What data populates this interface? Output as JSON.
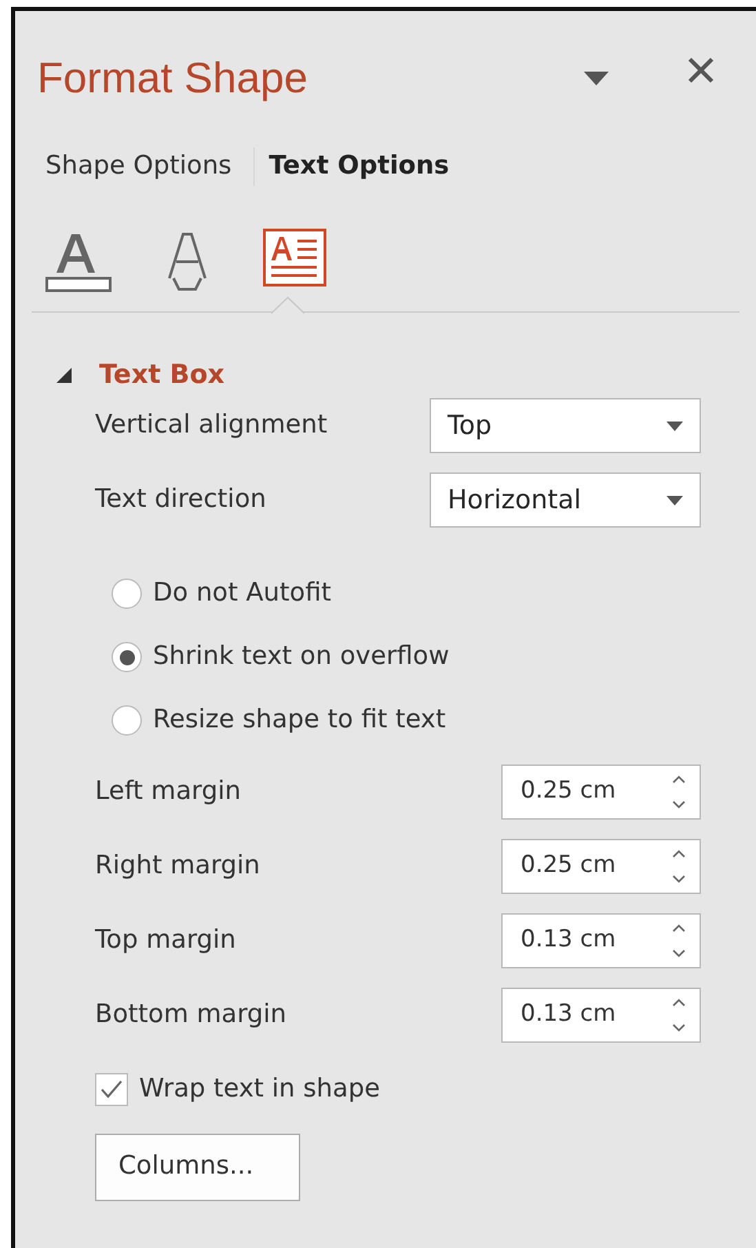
{
  "pane": {
    "title": "Format Shape"
  },
  "tabs": [
    {
      "label": "Shape Options",
      "selected": false
    },
    {
      "label": "Text Options",
      "selected": true
    }
  ],
  "icon_tabs": [
    {
      "kind": "fill",
      "selected": false
    },
    {
      "kind": "outline",
      "selected": false
    },
    {
      "kind": "textbox",
      "selected": true
    }
  ],
  "section": {
    "title": "Text Box",
    "expanded": true
  },
  "controls": [
    {
      "kind": "dropdown",
      "label": "Vertical alignment",
      "value": "Top"
    },
    {
      "kind": "dropdown",
      "label": "Text direction",
      "value": "Horizontal"
    },
    {
      "kind": "radio",
      "label": "Do not Autofit",
      "selected": false
    },
    {
      "kind": "radio",
      "label": "Shrink text on overflow",
      "selected": true
    },
    {
      "kind": "radio",
      "label": "Resize shape to fit text",
      "selected": false
    },
    {
      "kind": "spinner",
      "label": "Left margin",
      "value": "0.25 cm"
    },
    {
      "kind": "spinner",
      "label": "Right margin",
      "value": "0.25 cm"
    },
    {
      "kind": "spinner",
      "label": "Top margin",
      "value": "0.13 cm"
    },
    {
      "kind": "spinner",
      "label": "Bottom margin",
      "value": "0.13 cm"
    },
    {
      "kind": "checkbox",
      "label": "Wrap text in shape",
      "checked": true
    },
    {
      "kind": "button",
      "label": "Columns..."
    }
  ]
}
